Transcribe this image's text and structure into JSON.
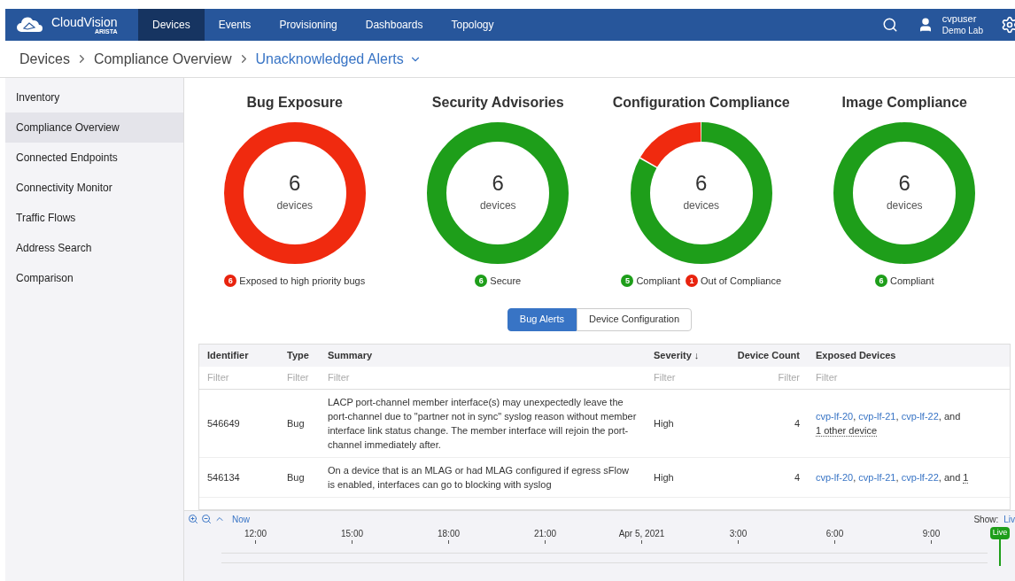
{
  "navbar": {
    "brand": "CloudVision",
    "brand_sub": "ARISTA",
    "items": [
      {
        "label": "Devices",
        "selected": true
      },
      {
        "label": "Events",
        "selected": false
      },
      {
        "label": "Provisioning",
        "selected": false
      },
      {
        "label": "Dashboards",
        "selected": false
      },
      {
        "label": "Topology",
        "selected": false
      }
    ],
    "user": {
      "name": "cvpuser",
      "org": "Demo Lab"
    }
  },
  "breadcrumb": [
    "Devices",
    "Compliance Overview"
  ],
  "breadcrumb_current": "Unacknowledged Alerts",
  "sidebar": {
    "items": [
      {
        "label": "Inventory",
        "selected": false
      },
      {
        "label": "Compliance Overview",
        "selected": true
      },
      {
        "label": "Connected Endpoints",
        "selected": false
      },
      {
        "label": "Connectivity Monitor",
        "selected": false
      },
      {
        "label": "Traffic Flows",
        "selected": false
      },
      {
        "label": "Address Search",
        "selected": false
      },
      {
        "label": "Comparison",
        "selected": false
      }
    ]
  },
  "summaries": [
    {
      "title": "Bug Exposure",
      "count": "6",
      "unit": "devices",
      "segments": [
        {
          "level": 1,
          "color": "#f02a0f"
        }
      ],
      "legend": [
        {
          "count": "6",
          "label": "Exposed to high priority bugs",
          "color": "#e8230e"
        }
      ]
    },
    {
      "title": "Security Advisories",
      "count": "6",
      "unit": "devices",
      "segments": [
        {
          "level": 1,
          "color": "#1e9e1a"
        }
      ],
      "legend": [
        {
          "count": "6",
          "label": "Secure",
          "color": "#1e9e1a"
        }
      ]
    },
    {
      "title": "Configuration Compliance",
      "count": "6",
      "unit": "devices",
      "segments": [
        {
          "level": 0.8333,
          "color": "#1e9e1a"
        },
        {
          "level": 0.1667,
          "color": "#f02a0f"
        }
      ],
      "legend": [
        {
          "count": "5",
          "label": "Compliant",
          "color": "#1e9e1a"
        },
        {
          "count": "1",
          "label": "Out of Compliance",
          "color": "#e8230e"
        }
      ]
    },
    {
      "title": "Image Compliance",
      "count": "6",
      "unit": "devices",
      "segments": [
        {
          "level": 1,
          "color": "#1e9e1a"
        }
      ],
      "legend": [
        {
          "count": "6",
          "label": "Compliant",
          "color": "#1e9e1a"
        }
      ]
    }
  ],
  "view_tabs": [
    {
      "label": "Bug Alerts",
      "selected": true
    },
    {
      "label": "Device Configuration",
      "selected": false
    }
  ],
  "table": {
    "columns": [
      {
        "label": "Identifier",
        "placeholder": "Filter",
        "kind": "text"
      },
      {
        "label": "Type",
        "placeholder": "Filter",
        "kind": "text"
      },
      {
        "label": "Summary",
        "placeholder": "Filter",
        "kind": "text"
      },
      {
        "label": "Severity ↓",
        "placeholder": "Filter",
        "kind": "text"
      },
      {
        "label": "Device Count",
        "placeholder": "Filter",
        "kind": "number"
      },
      {
        "label": "Exposed Devices",
        "placeholder": "Filter",
        "kind": "text"
      }
    ],
    "rows": [
      {
        "identifier": "546649",
        "type": "Bug",
        "summary": "LACP port-channel member interface(s) may unexpectedly leave the port-channel due to \"partner not in sync\" syslog reason without member interface link status change. The member interface will rejoin the port-channel immediately after.",
        "severity": "High",
        "device_count": "4",
        "devices": [
          "cvp-lf-20",
          "cvp-lf-21",
          "cvp-lf-22"
        ],
        "separator": ",",
        "conjunction": "and",
        "more": "1 other device"
      },
      {
        "identifier": "546134",
        "type": "Bug",
        "summary": "On a device that is an MLAG or had MLAG configured if egress sFlow is enabled, interfaces can go to blocking with syslog",
        "severity": "High",
        "device_count": "4",
        "devices": [
          "cvp-lf-20",
          "cvp-lf-21",
          "cvp-lf-22"
        ],
        "separator": ",",
        "conjunction": "and",
        "more": "1"
      }
    ]
  },
  "timeline": {
    "now": "Now",
    "show_label": "Show:",
    "show_value": "Liv",
    "ticks": [
      "12:00",
      "15:00",
      "18:00",
      "21:00",
      "Apr 5, 2021",
      "3:00",
      "6:00",
      "9:00"
    ],
    "live": "Live"
  }
}
